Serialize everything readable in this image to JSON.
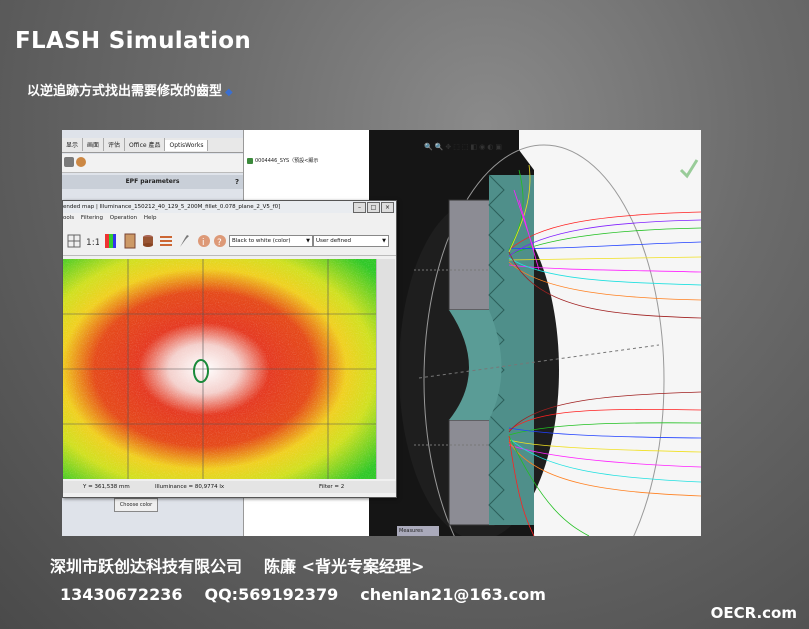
{
  "slide": {
    "title": "FLASH Simulation",
    "subtitle": "以逆追跡方式找出需要修改的齒型",
    "footer_company": "深圳市跃创达科技有限公司",
    "footer_person": "陈廉",
    "footer_role": "<背光专案经理>",
    "footer_phone": "13430672236",
    "footer_qq": "QQ:569192379",
    "footer_email": "chenlan21@163.com",
    "watermark": "OECR.com"
  },
  "app": {
    "tabs": [
      "显示",
      "画面",
      "评估",
      "Office 產品",
      "OptisWorks"
    ],
    "active_tab": "OptisWorks",
    "panel_title": "EPF parameters",
    "panel_help": "?",
    "choose_color": "Choose color",
    "tree_item": "0004446_SYS（預設<顯示",
    "measures": "Measures"
  },
  "result_window": {
    "title": "ended map | Illuminance_150212_40_129_5_200M_fillet_0.078_plane_2_V5_f0]",
    "menu": [
      "ools",
      "Filtering",
      "Operation",
      "Help"
    ],
    "color_scale": "Black to white (color)",
    "scale_mode": "User defined",
    "status_y": "Y = 361,538 mm",
    "status_illum": "Illuminance = 80,9774 lx",
    "status_filter": "Filter = 2"
  },
  "colors": {
    "accent_bullet": "#3a6fd0",
    "map_high": "#e02010",
    "map_mid": "#f0e020",
    "map_low": "#30c020"
  }
}
